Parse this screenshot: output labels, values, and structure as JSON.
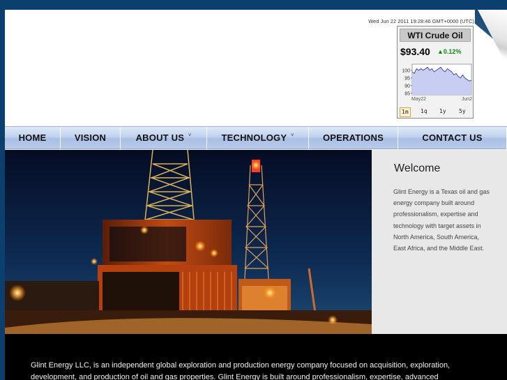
{
  "header": {
    "datetime": "Wed Jun 22 2011 19:28:46 GMT+0000 (UTC)."
  },
  "oil_widget": {
    "title": "WTI Crude Oil",
    "price": "$93.40",
    "change": "0.12%",
    "change_direction": "up",
    "change_color": "#0a8a0a",
    "chart_data": {
      "type": "area",
      "x_labels": [
        "May22",
        "Jun2"
      ],
      "y_ticks": [
        85,
        90,
        95,
        100
      ],
      "ylim": [
        84,
        104
      ],
      "values": [
        99,
        98,
        101,
        100,
        101,
        100,
        101,
        102,
        100,
        101,
        99,
        100,
        101,
        102,
        100,
        99,
        101,
        100,
        99,
        97,
        98,
        96,
        95,
        97,
        95,
        94,
        93,
        93.4
      ],
      "fill_color": "#c8cdf2",
      "line_color": "#3a3f9a"
    },
    "periods": [
      "1m",
      "1q",
      "1y",
      "5y"
    ],
    "active_period": "1m"
  },
  "nav": {
    "items": [
      {
        "label": "HOME",
        "has_dropdown": false
      },
      {
        "label": "VISION",
        "has_dropdown": false
      },
      {
        "label": "ABOUT US",
        "has_dropdown": true
      },
      {
        "label": "TECHNOLOGY",
        "has_dropdown": true
      },
      {
        "label": "OPERATIONS",
        "has_dropdown": false
      },
      {
        "label": "CONTACT US",
        "has_dropdown": false
      }
    ],
    "dropdown_icon": "chevron-down-icon"
  },
  "hero": {
    "image": "drilling-rig-night-photo"
  },
  "welcome": {
    "title": "Welcome",
    "text": "Glint Energy is a Texas oil and gas energy company built around professionalism, expertise and technology with target assets in North America, South America, East Africa, and the Middle East."
  },
  "about": {
    "text": "Glint Energy LLC, is an independent global exploration and production energy company focused on acquisition, exploration, development, and production of oil and gas properties. Glint Energy is built around professionalism, expertise, advanced"
  }
}
